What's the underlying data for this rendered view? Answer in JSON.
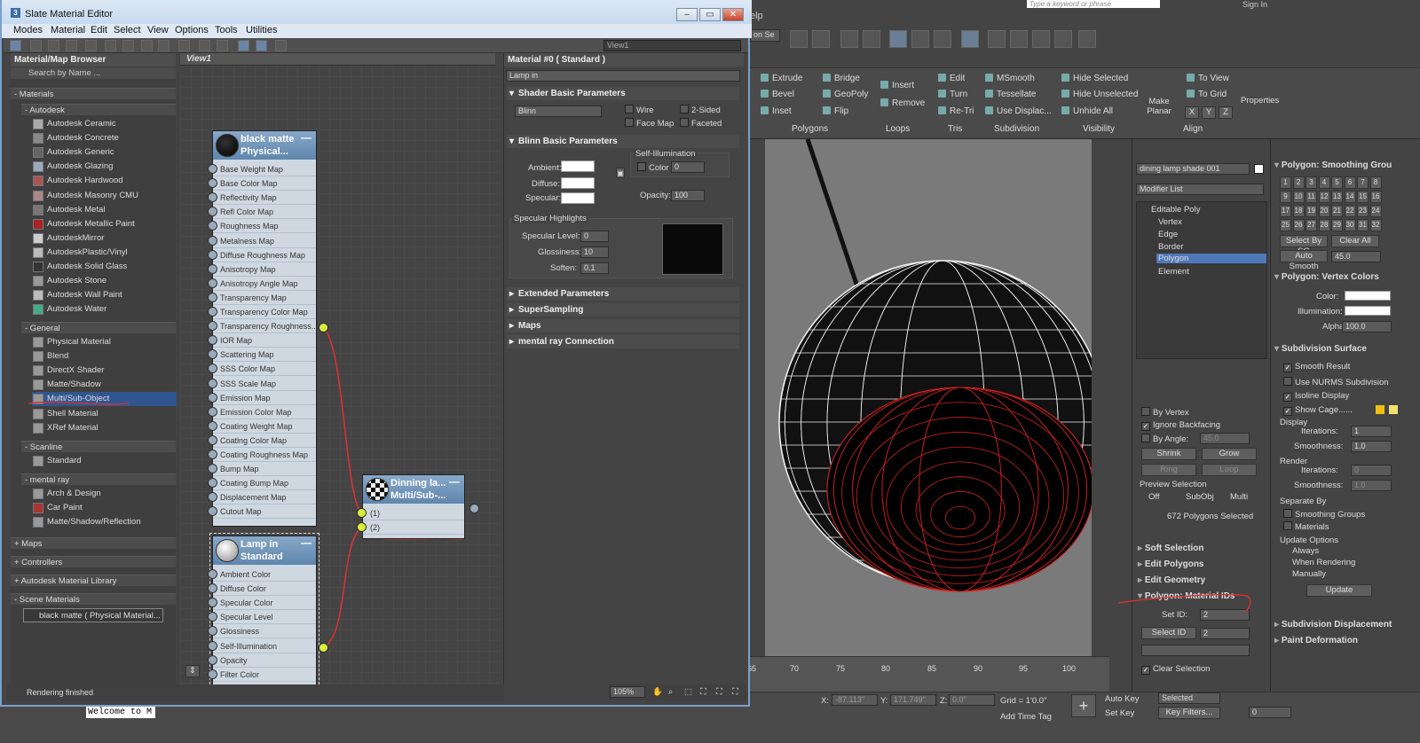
{
  "max": {
    "search_placeholder": "Type a keyword or phrase",
    "signin": "Sign In",
    "help_menu": "elp",
    "selection_set": "on Se",
    "ribbon": {
      "polygons": {
        "title": "Polygons",
        "items": [
          "Extrude",
          "Bevel",
          "Inset",
          "Bridge",
          "GeoPoly",
          "Flip"
        ]
      },
      "loops": {
        "title": "Loops",
        "items": [
          "Insert",
          "Remove"
        ]
      },
      "tris": {
        "title": "Tris",
        "items": [
          "Edit",
          "Turn",
          "Re-Tri"
        ]
      },
      "subdivision": {
        "title": "Subdivision",
        "items": [
          "MSmooth",
          "Tessellate",
          "Use Displac..."
        ]
      },
      "visibility": {
        "title": "Visibility",
        "items": [
          "Hide Selected",
          "Hide Unselected",
          "Unhide All"
        ]
      },
      "align": {
        "title": "Align",
        "make_planar": "Make Planar",
        "to_view": "To View",
        "to_grid": "To Grid",
        "x": "X",
        "y": "Y",
        "z": "Z"
      },
      "properties": "Properties"
    },
    "timeline_ticks": [
      "65",
      "70",
      "75",
      "80",
      "85",
      "90",
      "95",
      "100"
    ],
    "status": {
      "x_label": "X:",
      "x": "-87.113\"",
      "y_label": "Y:",
      "y": "171.749\"",
      "z_label": "Z:",
      "z": "0.0\"",
      "grid": "Grid = 1'0.0\"",
      "add_time_tag": "Add Time Tag",
      "auto_key": "Auto Key",
      "set_key": "Set Key",
      "selected": "Selected",
      "key_filters": "Key Filters...",
      "frame": "0"
    },
    "command": {
      "object_name": "dining lamp shade 001",
      "modifier_list": "Modifier List",
      "stack": [
        "Editable Poly",
        "Vertex",
        "Edge",
        "Border",
        "Polygon",
        "Element"
      ],
      "by_vertex": "By Vertex",
      "ignore_backfacing": "Ignore Backfacing",
      "by_angle": "By Angle:",
      "angle": "45.0",
      "shrink": "Shrink",
      "grow": "Grow",
      "ring": "Ring",
      "loop": "Loop",
      "preview_selection": "Preview Selection",
      "off": "Off",
      "subobj": "SubObj",
      "multi": "Multi",
      "selected_count": "672 Polygons Selected",
      "soft_selection": "Soft Selection",
      "edit_polygons": "Edit Polygons",
      "edit_geometry": "Edit Geometry",
      "material_ids": "Polygon: Material IDs",
      "set_id": "Set ID:",
      "set_id_val": "2",
      "select_id": "Select ID",
      "select_id_val": "2",
      "clear_selection": "Clear Selection"
    },
    "right": {
      "smoothing_title": "Polygon: Smoothing Grou",
      "sg": [
        "1",
        "2",
        "3",
        "4",
        "5",
        "6",
        "7",
        "8",
        "9",
        "10",
        "11",
        "12",
        "13",
        "14",
        "15",
        "16",
        "17",
        "18",
        "19",
        "20",
        "21",
        "22",
        "23",
        "24",
        "25",
        "26",
        "27",
        "28",
        "29",
        "30",
        "31",
        "32"
      ],
      "select_by_sg": "Select By SG",
      "clear_all": "Clear All",
      "auto_smooth": "Auto Smooth",
      "auto_smooth_val": "45.0",
      "vertex_colors": "Polygon: Vertex Colors",
      "color": "Color:",
      "illumination": "Illumination:",
      "alpha": "Alpha:",
      "alpha_val": "100.0",
      "subdiv_surface": "Subdivision Surface",
      "smooth_result": "Smooth Result",
      "use_nurms": "Use NURMS Subdivision",
      "isoline": "Isoline Display",
      "show_cage": "Show Cage......",
      "display": "Display",
      "iterations": "Iterations:",
      "iter_val": "1",
      "smoothness": "Smoothness:",
      "smooth_val": "1.0",
      "render": "Render",
      "r_iter": "0",
      "r_smooth": "1.0",
      "separate_by": "Separate By",
      "smoothing_groups": "Smoothing Groups",
      "materials": "Materials",
      "update_options": "Update Options",
      "always": "Always",
      "when_rendering": "When Rendering",
      "manually": "Manually",
      "update": "Update",
      "subdiv_displacement": "Subdivision Displacement",
      "paint_deformation": "Paint Deformation"
    }
  },
  "slate": {
    "title": "Slate Material Editor",
    "menu": [
      "Modes",
      "Material",
      "Edit",
      "Select",
      "View",
      "Options",
      "Tools",
      "Utilities"
    ],
    "view_dropdown": "View1",
    "browser": {
      "title": "Material/Map Browser",
      "search": "Search by Name ...",
      "groups": {
        "materials": "- Materials",
        "autodesk": "- Autodesk",
        "general": "- General",
        "scanline": "- Scanline",
        "mentalray": "- mental ray",
        "maps": "+ Maps",
        "controllers": "+ Controllers",
        "library": "+ Autodesk Material Library",
        "scene": "- Scene Materials"
      },
      "autodesk_items": [
        "Autodesk Ceramic",
        "Autodesk Concrete",
        "Autodesk Generic",
        "Autodesk Glazing",
        "Autodesk Hardwood",
        "Autodesk Masonry CMU",
        "Autodesk Metal",
        "Autodesk Metallic Paint",
        "AutodeskMirror",
        "AutodeskPlastic/Vinyl",
        "Autodesk Solid Glass",
        "Autodesk Stone",
        "Autodesk Wall Paint",
        "Autodesk Water"
      ],
      "general_items": [
        "Physical Material",
        "Blend",
        "DirectX Shader",
        "Matte/Shadow",
        "Multi/Sub-Object",
        "Shell Material",
        "XRef Material"
      ],
      "scanline_items": [
        "Standard"
      ],
      "mentalray_items": [
        "Arch & Design",
        "Car Paint",
        "Matte/Shadow/Reflection"
      ],
      "scene_items": [
        "black matte  ( Physical Material..."
      ]
    },
    "view_tab": "View1",
    "node1": {
      "name1": "black matte",
      "name2": "Physical...",
      "slots": [
        "Base Weight Map",
        "Base Color Map",
        "Reflectivity Map",
        "Refl Color Map",
        "Roughness Map",
        "Metalness Map",
        "Diffuse Roughness Map",
        "Anisotropy Map",
        "Anisotropy Angle Map",
        "Transparency Map",
        "Transparency Color Map",
        "Transparency Roughness...",
        "IOR Map",
        "Scattering Map",
        "SSS Color Map",
        "SSS Scale Map",
        "Emission Map",
        "Emission Color Map",
        "Coating Weight Map",
        "Coating Color Map",
        "Coating Roughness Map",
        "Bump Map",
        "Coating Bump Map",
        "Displacement Map",
        "Cutout Map"
      ]
    },
    "node2": {
      "name1": "Lamp in",
      "name2": "Standard",
      "slots": [
        "Ambient Color",
        "Diffuse Color",
        "Specular Color",
        "Specular Level",
        "Glossiness",
        "Self-Illumination",
        "Opacity",
        "Filter Color"
      ]
    },
    "node3": {
      "name1": "Dinning la...",
      "name2": "Multi/Sub-...",
      "slots": [
        "(1)",
        "(2)"
      ]
    },
    "params": {
      "title": "Material #0  ( Standard )",
      "name": "Lamp in",
      "shader_basic": "Shader Basic Parameters",
      "shader": "Blinn",
      "wire": "Wire",
      "two_sided": "2-Sided",
      "face_map": "Face Map",
      "faceted": "Faceted",
      "blinn_basic": "Blinn Basic Parameters",
      "self_illum": "Self-Illumination",
      "color": "Color",
      "color_val": "0",
      "ambient": "Ambient:",
      "diffuse": "Diffuse:",
      "specular": "Specular:",
      "opacity": "Opacity:",
      "opacity_val": "100",
      "spec_highlights": "Specular Highlights",
      "spec_level": "Specular Level:",
      "spec_level_val": "0",
      "glossiness": "Glossiness:",
      "gloss_val": "10",
      "soften": "Soften:",
      "soften_val": "0.1",
      "extended": "Extended Parameters",
      "supersampling": "SuperSampling",
      "maps": "Maps",
      "mentalray": "mental ray Connection"
    },
    "status": "Rendering finished",
    "zoom": "105%"
  },
  "taskbar": {
    "welcome": "Welcome to M"
  }
}
